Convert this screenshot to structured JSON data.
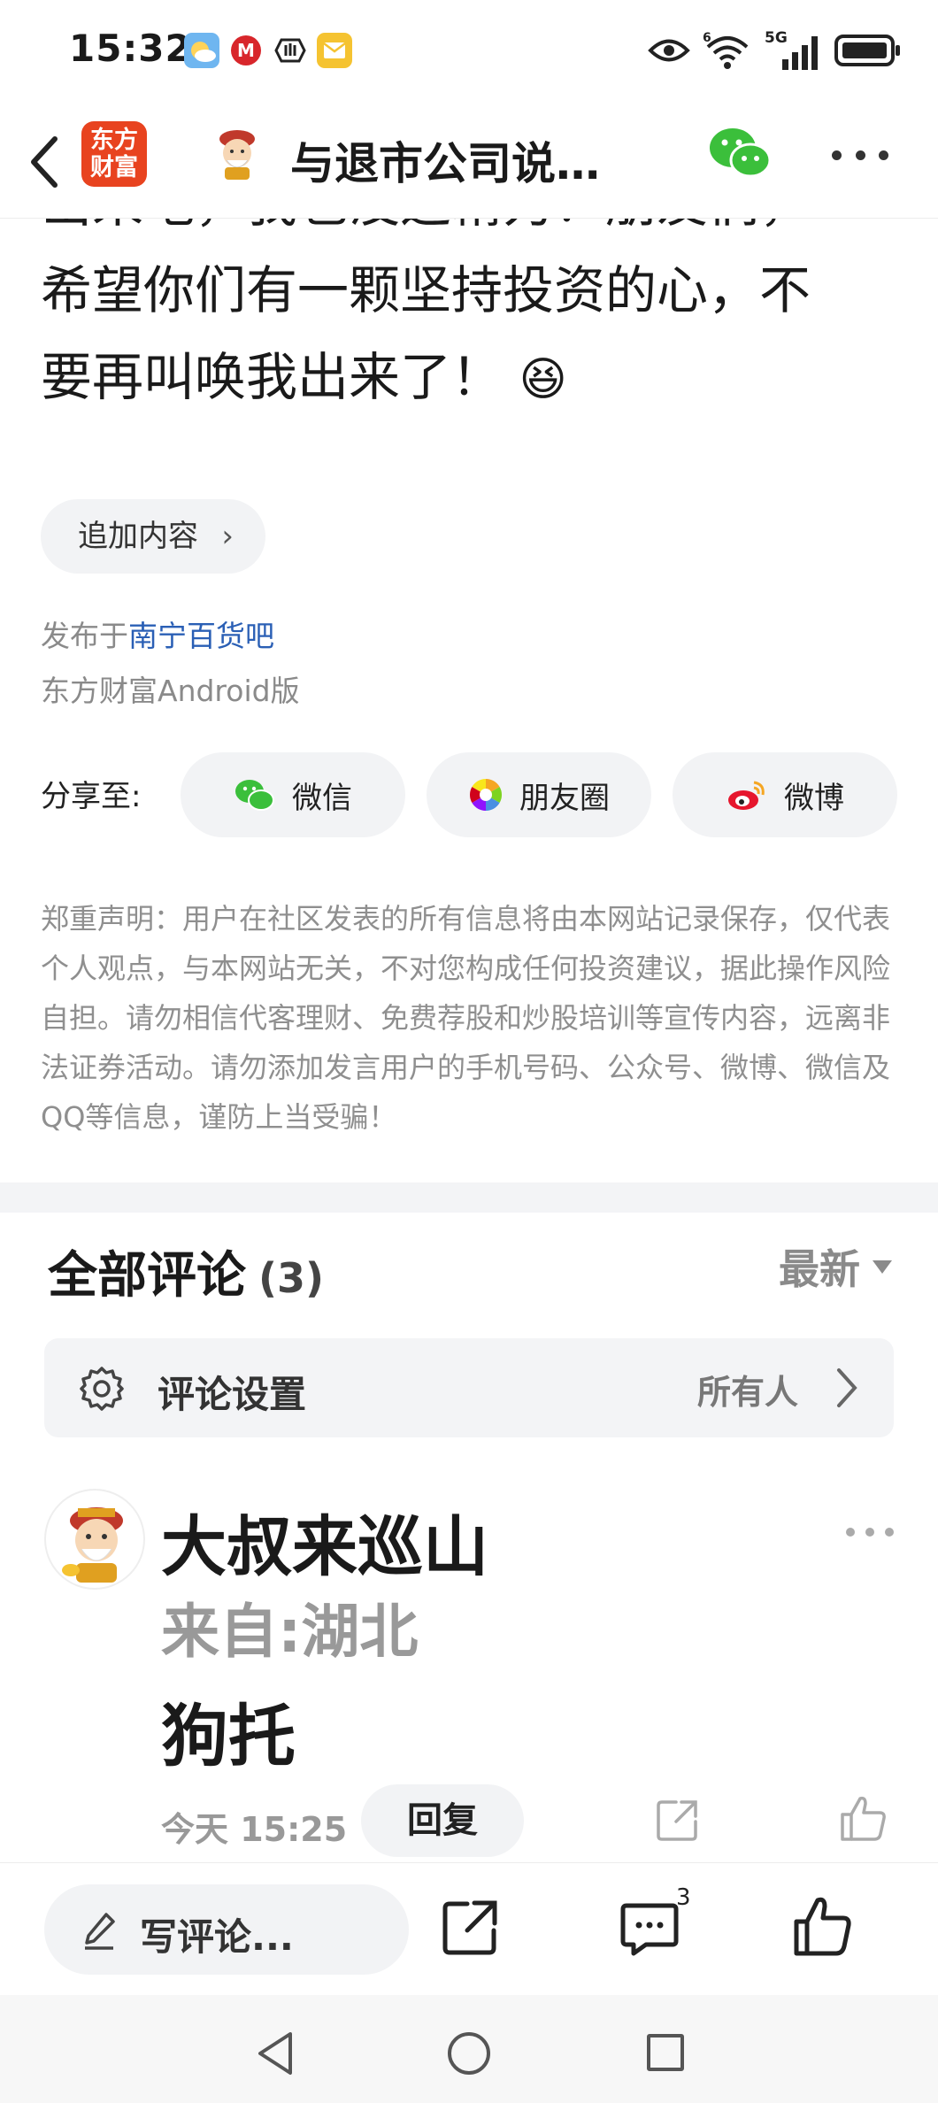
{
  "status_bar": {
    "time": "15:32",
    "network_label": "5G",
    "sim_label": "6"
  },
  "header": {
    "back_icon": "chevron-left-icon",
    "app_logo_line1": "东方",
    "app_logo_line2": "财富",
    "title": "与退市公司说…",
    "wechat_icon": "wechat-icon",
    "more_icon": "more-icon"
  },
  "article": {
    "partial_line": "出来吧，我也没这精力！朋友们，",
    "line2": "希望你们有一颗坚持投资的心，不",
    "line3": "要再叫唤我出来了！",
    "emoji": "😆"
  },
  "append_button": "追加内容",
  "meta": {
    "published_prefix": "发布于",
    "forum_name": "南宁百货吧",
    "client": "东方财富Android版"
  },
  "share": {
    "label": "分享至:",
    "targets": [
      {
        "label": "微信",
        "icon": "wechat-icon"
      },
      {
        "label": "朋友圈",
        "icon": "moments-icon"
      },
      {
        "label": "微博",
        "icon": "weibo-icon"
      }
    ]
  },
  "disclaimer": "郑重声明：用户在社区发表的所有信息将由本网站记录保存，仅代表个人观点，与本网站无关，不对您构成任何投资建议，据此操作风险自担。请勿相信代客理财、免费荐股和炒股培训等宣传内容，远离非法证券活动。请勿添加发言用户的手机号码、公众号、微博、微信及QQ等信息，谨防上当受骗！",
  "comments": {
    "title": "全部评论",
    "count": "(3)",
    "sort_label": "最新",
    "settings_label": "评论设置",
    "settings_value": "所有人",
    "items": [
      {
        "user": "大叔来巡山",
        "location": "来自:湖北",
        "text": "狗托",
        "time": "今天 15:25",
        "reply_label": "回复"
      }
    ]
  },
  "bottom_bar": {
    "write_placeholder": "写评论...",
    "comment_badge": "3"
  },
  "colors": {
    "brand_red": "#e8431f",
    "link_blue": "#2a5fb5",
    "wechat_green": "#3bbf3b"
  }
}
